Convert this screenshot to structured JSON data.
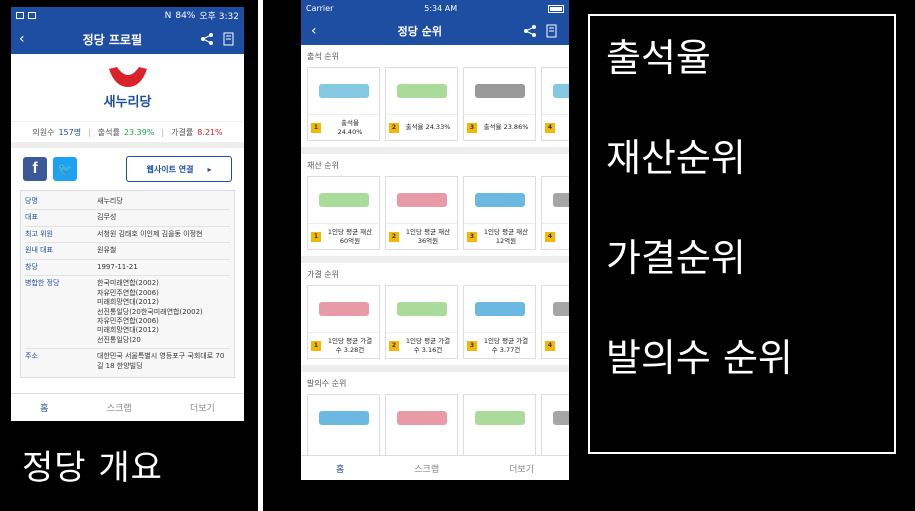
{
  "left_phone": {
    "status_bar": {
      "signal": "N",
      "battery": "84%",
      "time": "오후 3:32"
    },
    "app_bar": {
      "title": "정당 프로필"
    },
    "logo": {
      "text": "새누리당"
    },
    "stats": {
      "members_label": "의원수",
      "members_value": "157명",
      "attendance_label": "출석률",
      "attendance_value": "23.39%",
      "vote_label": "가결률",
      "vote_value": "8.21%"
    },
    "website_button": "웹사이트 연결",
    "info": [
      {
        "key": "당명",
        "value": "새누리당"
      },
      {
        "key": "대표",
        "value": "김무성"
      },
      {
        "key": "최고 위원",
        "value": "서청원 김태호 이인제 김을동 이정현"
      },
      {
        "key": "원내 대표",
        "value": "원유철"
      },
      {
        "key": "창당",
        "value": "1997-11-21"
      },
      {
        "key": "병합한 정당",
        "value": "한국미래연합(2002)\n자유민주연합(2006)\n미래희망연대(2012)\n선진통일당(20한국미래연합(2002)\n자유민주연합(2006)\n미래희망연대(2012)\n선진통일당(20"
      },
      {
        "key": "주소",
        "value": "대한민국 서울특별시 영등포구 국회대로 70길 18 한양빌딩"
      }
    ],
    "tabs": [
      "홈",
      "스크랩",
      "더보기"
    ],
    "caption": "정당 개요"
  },
  "mid_phone": {
    "status_bar": {
      "carrier": "Carrier",
      "time": "5:34 AM"
    },
    "app_bar": {
      "title": "정당 순위"
    },
    "sections": [
      {
        "title": "출석 순위",
        "cards": [
          {
            "rank": "1",
            "label": "출석율\n24.40%",
            "color": "#5bb5d8"
          },
          {
            "rank": "2",
            "label": "출석율 24.33%",
            "color": "#8fcf7a"
          },
          {
            "rank": "3",
            "label": "출석율 23.86%",
            "color": "#777777"
          },
          {
            "rank": "4",
            "label": "출석",
            "color": "#5bb5d8"
          }
        ]
      },
      {
        "title": "재산 순위",
        "cards": [
          {
            "rank": "1",
            "label": "1인당 평균 재산\n60억원",
            "color": "#8fcf7a"
          },
          {
            "rank": "2",
            "label": "1인당 평균 재산\n36억원",
            "color": "#e07a8a"
          },
          {
            "rank": "3",
            "label": "1인당 평균 재산\n12억원",
            "color": "#3aa0d8"
          },
          {
            "rank": "4",
            "label": "1인",
            "color": "#888888"
          }
        ]
      },
      {
        "title": "가결 순위",
        "cards": [
          {
            "rank": "1",
            "label": "1인당 평균 가결\n수 3.28건",
            "color": "#e07a8a"
          },
          {
            "rank": "2",
            "label": "1인당 평균 가결\n수 3.16건",
            "color": "#8fcf7a"
          },
          {
            "rank": "3",
            "label": "1인당 평균 가결\n수 3.77건",
            "color": "#3aa0d8"
          },
          {
            "rank": "4",
            "label": "1인",
            "color": "#888888"
          }
        ]
      },
      {
        "title": "발의수 순위",
        "cards": [
          {
            "rank": "1",
            "label": "",
            "color": "#3aa0d8"
          },
          {
            "rank": "2",
            "label": "",
            "color": "#e07a8a"
          },
          {
            "rank": "3",
            "label": "",
            "color": "#8fcf7a"
          },
          {
            "rank": "4",
            "label": "",
            "color": "#888888"
          }
        ]
      }
    ],
    "tabs": [
      "홈",
      "스크랩",
      "더보기"
    ]
  },
  "legend": [
    "출석율",
    "재산순위",
    "가결순위",
    "발의수 순위"
  ]
}
